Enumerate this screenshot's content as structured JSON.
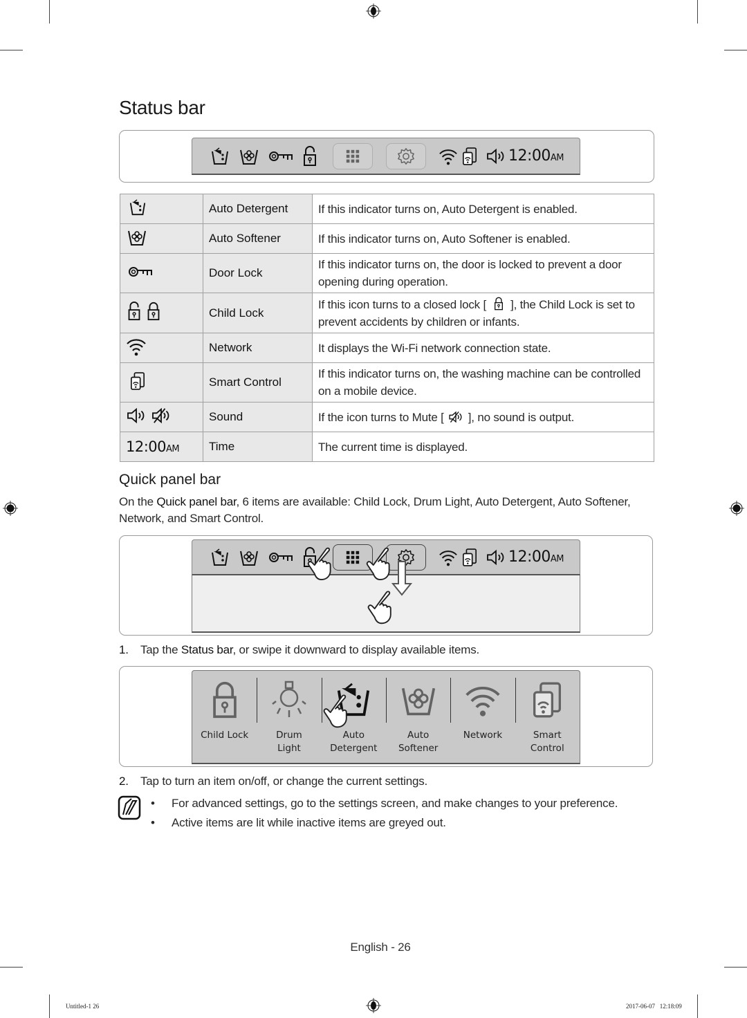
{
  "page": {
    "title": "Status bar",
    "page_number": "English - 26",
    "footer_left": "Untitled-1   26",
    "footer_right": "2017-06-07     12:18:09"
  },
  "status_bar": {
    "time": "12:00",
    "time_suffix": "AM",
    "icons": [
      "auto-detergent-icon",
      "auto-softener-icon",
      "door-lock-icon",
      "child-lock-open-icon",
      "apps-grid-icon",
      "settings-gear-icon",
      "wifi-icon",
      "smart-control-icon",
      "sound-icon"
    ]
  },
  "table": {
    "rows": [
      {
        "icon": "auto-detergent",
        "name": "Auto Detergent",
        "desc": "If this indicator turns on, Auto Detergent is enabled."
      },
      {
        "icon": "auto-softener",
        "name": "Auto Softener",
        "desc": "If this indicator turns on, Auto Softener is enabled."
      },
      {
        "icon": "door-lock",
        "name": "Door Lock",
        "desc": "If this indicator turns on, the door is locked to prevent a door opening during operation."
      },
      {
        "icon": "child-lock",
        "name": "Child Lock",
        "desc_pre": "If this icon turns to a closed lock [",
        "desc_post": "], the Child Lock is set to prevent accidents by children or infants."
      },
      {
        "icon": "network",
        "name": "Network",
        "desc": "It displays the Wi-Fi network connection state."
      },
      {
        "icon": "smart-control",
        "name": "Smart Control",
        "desc": "If this indicator turns on, the washing machine can be controlled on a mobile device."
      },
      {
        "icon": "sound",
        "name": "Sound",
        "desc_pre": "If the icon turns to Mute [",
        "desc_post": "], no sound is output."
      },
      {
        "icon": "time",
        "name": "Time",
        "icon_text": "12:00",
        "icon_suffix": "AM",
        "desc": "The current time is displayed."
      }
    ]
  },
  "quick_panel": {
    "heading": "Quick panel bar",
    "intro_pre": "On the ",
    "intro_bold": "Quick panel bar",
    "intro_post": ", 6 items are available: Child Lock, Drum Light, Auto Detergent, Auto Softener, Network, and Smart Control.",
    "step1_num": "1.",
    "step1_pre": "Tap the ",
    "step1_bold": "Status bar",
    "step1_post": ", or swipe it downward to display available items.",
    "items": [
      {
        "label_1": "Child Lock",
        "label_2": ""
      },
      {
        "label_1": "Drum",
        "label_2": "Light"
      },
      {
        "label_1": "Auto",
        "label_2": "Detergent"
      },
      {
        "label_1": "Auto",
        "label_2": "Softener"
      },
      {
        "label_1": "Network",
        "label_2": ""
      },
      {
        "label_1": "Smart",
        "label_2": "Control"
      }
    ],
    "step2_num": "2.",
    "step2_text": "Tap to turn an item on/off, or change the current settings.",
    "notes": [
      "For advanced settings, go to the settings screen, and make changes to your preference.",
      "Active items are lit while inactive items are greyed out."
    ]
  }
}
